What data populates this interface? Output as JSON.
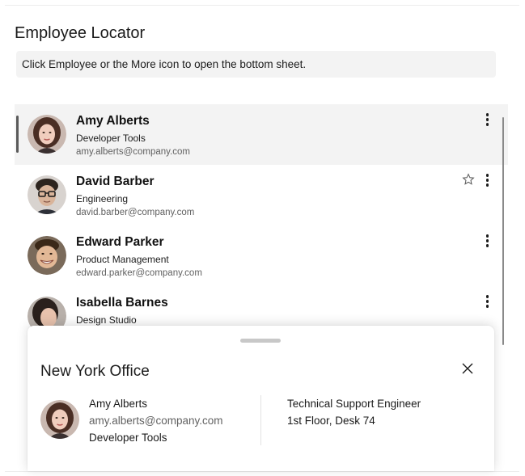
{
  "page": {
    "title": "Employee Locator",
    "hint": "Click Employee or the More icon to open the bottom sheet."
  },
  "employees": [
    {
      "name": "Amy Alberts",
      "department": "Developer Tools",
      "email": "amy.alberts@company.com",
      "selected": true,
      "favorite_icon": false
    },
    {
      "name": "David Barber",
      "department": "Engineering",
      "email": "david.barber@company.com",
      "selected": false,
      "favorite_icon": true
    },
    {
      "name": "Edward Parker",
      "department": "Product Management",
      "email": "edward.parker@company.com",
      "selected": false,
      "favorite_icon": false
    },
    {
      "name": "Isabella Barnes",
      "department": "Design Studio",
      "email": "",
      "selected": false,
      "favorite_icon": false
    }
  ],
  "icons": {
    "more": "more-vertical-icon",
    "favorite": "star-outline-icon",
    "close": "close-icon"
  },
  "bottom_sheet": {
    "title": "New York Office",
    "name": "Amy Alberts",
    "email": "amy.alberts@company.com",
    "department": "Developer Tools",
    "role": "Technical Support Engineer",
    "location": "1st Floor, Desk 74"
  },
  "colors": {
    "accent_bar": "#5a5a5a",
    "selected_row": "#f3f3f3",
    "secondary_text": "#616161"
  }
}
